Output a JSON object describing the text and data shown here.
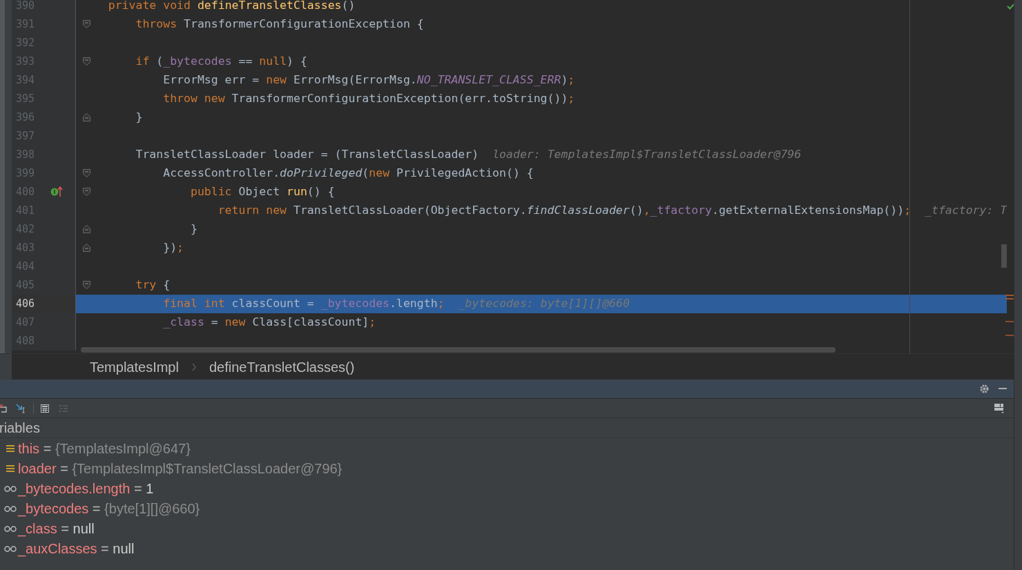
{
  "editor": {
    "lines": [
      {
        "number": "390",
        "current": false,
        "fold_open": false,
        "fold_close": false,
        "override_marker": false,
        "tokens": [
          {
            "kind": "kw",
            "text": "    private void "
          },
          {
            "kind": "decl",
            "text": "defineTransletClasses"
          },
          {
            "kind": "text",
            "text": "()"
          }
        ]
      },
      {
        "number": "391",
        "current": false,
        "fold_open": true,
        "fold_close": false,
        "override_marker": false,
        "tokens": [
          {
            "kind": "kw",
            "text": "        throws "
          },
          {
            "kind": "text",
            "text": "TransformerConfigurationException {"
          }
        ]
      },
      {
        "number": "392",
        "current": false,
        "fold_open": false,
        "fold_close": false,
        "override_marker": false
      },
      {
        "number": "393",
        "current": false,
        "fold_open": true,
        "fold_close": false,
        "override_marker": false,
        "tokens": [
          {
            "kind": "kw",
            "text": "        if "
          },
          {
            "kind": "text",
            "text": "("
          },
          {
            "kind": "field",
            "text": "_bytecodes"
          },
          {
            "kind": "text",
            "text": " == "
          },
          {
            "kind": "kw",
            "text": "null"
          },
          {
            "kind": "text",
            "text": ") {"
          }
        ]
      },
      {
        "number": "394",
        "current": false,
        "fold_open": false,
        "fold_close": false,
        "override_marker": false,
        "tokens": [
          {
            "kind": "text",
            "text": "            ErrorMsg err = "
          },
          {
            "kind": "kw",
            "text": "new "
          },
          {
            "kind": "text",
            "text": "ErrorMsg(ErrorMsg."
          },
          {
            "kind": "static",
            "text": "NO_TRANSLET_CLASS_ERR"
          },
          {
            "kind": "text",
            "text": ")"
          },
          {
            "kind": "kw",
            "text": ";"
          }
        ]
      },
      {
        "number": "395",
        "current": false,
        "fold_open": false,
        "fold_close": false,
        "override_marker": false,
        "tokens": [
          {
            "kind": "kw",
            "text": "            throw new "
          },
          {
            "kind": "text",
            "text": "TransformerConfigurationException(err.toString())"
          },
          {
            "kind": "kw",
            "text": ";"
          }
        ]
      },
      {
        "number": "396",
        "current": false,
        "fold_open": false,
        "fold_close": true,
        "override_marker": false,
        "tokens": [
          {
            "kind": "text",
            "text": "        }"
          }
        ]
      },
      {
        "number": "397",
        "current": false,
        "fold_open": false,
        "fold_close": false,
        "override_marker": false
      },
      {
        "number": "398",
        "current": false,
        "fold_open": false,
        "fold_close": false,
        "override_marker": false,
        "tokens": [
          {
            "kind": "text",
            "text": "        TransletClassLoader loader = (TransletClassLoader)"
          }
        ],
        "hint": "loader: TemplatesImpl$TransletClassLoader@796"
      },
      {
        "number": "399",
        "current": false,
        "fold_open": true,
        "fold_close": false,
        "override_marker": false,
        "tokens": [
          {
            "kind": "text",
            "text": "            AccessController."
          },
          {
            "kind": "call",
            "text": "doPrivileged"
          },
          {
            "kind": "text",
            "text": "("
          },
          {
            "kind": "kw",
            "text": "new "
          },
          {
            "kind": "text",
            "text": "PrivilegedAction() {"
          }
        ]
      },
      {
        "number": "400",
        "current": false,
        "fold_open": true,
        "fold_close": false,
        "override_marker": true,
        "tokens": [
          {
            "kind": "kw",
            "text": "                public "
          },
          {
            "kind": "text",
            "text": "Object "
          },
          {
            "kind": "decl",
            "text": "run"
          },
          {
            "kind": "text",
            "text": "() {"
          }
        ]
      },
      {
        "number": "401",
        "current": false,
        "fold_open": false,
        "fold_close": false,
        "override_marker": false,
        "tokens": [
          {
            "kind": "kw",
            "text": "                    return new "
          },
          {
            "kind": "text",
            "text": "TransletClassLoader(ObjectFactory."
          },
          {
            "kind": "call",
            "text": "findClassLoader"
          },
          {
            "kind": "text",
            "text": "()"
          },
          {
            "kind": "kw",
            "text": ","
          },
          {
            "kind": "field",
            "text": "_tfactory"
          },
          {
            "kind": "text",
            "text": ".getExternalExtensionsMap())"
          },
          {
            "kind": "kw",
            "text": ";"
          }
        ],
        "hint": "_tfactory: T"
      },
      {
        "number": "402",
        "current": false,
        "fold_open": false,
        "fold_close": true,
        "override_marker": false,
        "tokens": [
          {
            "kind": "text",
            "text": "                }"
          }
        ]
      },
      {
        "number": "403",
        "current": false,
        "fold_open": false,
        "fold_close": true,
        "override_marker": false,
        "tokens": [
          {
            "kind": "text",
            "text": "            })"
          },
          {
            "kind": "kw",
            "text": ";"
          }
        ]
      },
      {
        "number": "404",
        "current": false,
        "fold_open": false,
        "fold_close": false,
        "override_marker": false
      },
      {
        "number": "405",
        "current": false,
        "fold_open": true,
        "fold_close": false,
        "override_marker": false,
        "tokens": [
          {
            "kind": "kw",
            "text": "        try "
          },
          {
            "kind": "text",
            "text": "{"
          }
        ]
      },
      {
        "number": "406",
        "current": true,
        "fold_open": false,
        "fold_close": false,
        "override_marker": false,
        "tokens": [
          {
            "kind": "kw",
            "text": "            final int "
          },
          {
            "kind": "text",
            "text": "classCount = "
          },
          {
            "kind": "field",
            "text": "_bytecodes"
          },
          {
            "kind": "text",
            "text": ".length"
          },
          {
            "kind": "kw",
            "text": ";"
          }
        ],
        "hint": "_bytecodes: byte[1][]@660"
      },
      {
        "number": "407",
        "current": false,
        "fold_open": false,
        "fold_close": false,
        "override_marker": false,
        "tokens": [
          {
            "kind": "field",
            "text": "            _class"
          },
          {
            "kind": "text",
            "text": " = "
          },
          {
            "kind": "kw",
            "text": "new "
          },
          {
            "kind": "text",
            "text": "Class[classCount]"
          },
          {
            "kind": "kw",
            "text": ";"
          }
        ]
      },
      {
        "number": "408",
        "current": false,
        "fold_open": false,
        "fold_close": false,
        "override_marker": false
      }
    ]
  },
  "breadcrumbs": [
    "TemplatesImpl",
    "defineTransletClasses()"
  ],
  "variables": {
    "title": "riables",
    "items": [
      {
        "kind": "field",
        "name": "this",
        "operator": "=",
        "value": {
          "kind": "object",
          "text": "{TemplatesImpl@647}"
        }
      },
      {
        "kind": "field",
        "name": "loader",
        "operator": "=",
        "value": {
          "kind": "object",
          "text": "{TemplatesImpl$TransletClassLoader@796}"
        }
      },
      {
        "kind": "watch",
        "name": "_bytecodes.length",
        "operator": "=",
        "value": {
          "kind": "plain",
          "text": "1"
        }
      },
      {
        "kind": "watch",
        "name": "_bytecodes",
        "operator": "=",
        "value": {
          "kind": "object",
          "text": "{byte[1][]@660}"
        }
      },
      {
        "kind": "watch",
        "name": "_class",
        "operator": "=",
        "value": {
          "kind": "plain",
          "text": "null"
        }
      },
      {
        "kind": "watch",
        "name": "_auxClasses",
        "operator": "=",
        "value": {
          "kind": "plain",
          "text": "null"
        }
      }
    ]
  }
}
